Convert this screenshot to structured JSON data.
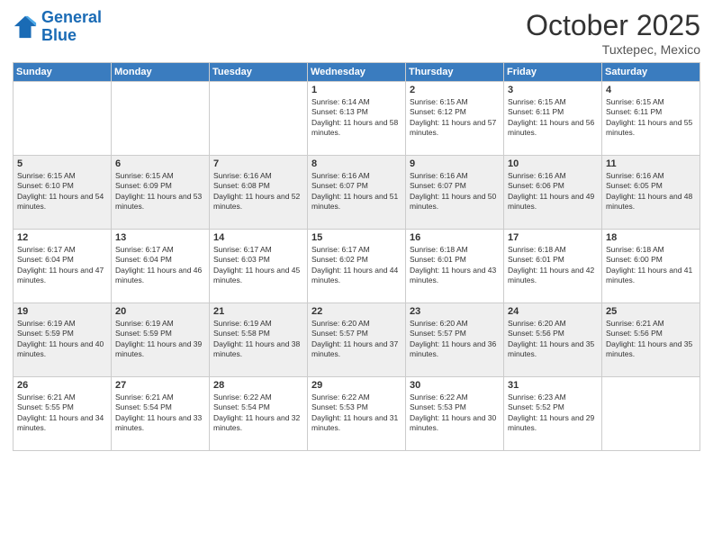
{
  "header": {
    "logo_line1": "General",
    "logo_line2": "Blue",
    "month": "October 2025",
    "location": "Tuxtepec, Mexico"
  },
  "days_of_week": [
    "Sunday",
    "Monday",
    "Tuesday",
    "Wednesday",
    "Thursday",
    "Friday",
    "Saturday"
  ],
  "weeks": [
    [
      {
        "day": "",
        "sunrise": "",
        "sunset": "",
        "daylight": ""
      },
      {
        "day": "",
        "sunrise": "",
        "sunset": "",
        "daylight": ""
      },
      {
        "day": "",
        "sunrise": "",
        "sunset": "",
        "daylight": ""
      },
      {
        "day": "1",
        "sunrise": "Sunrise: 6:14 AM",
        "sunset": "Sunset: 6:13 PM",
        "daylight": "Daylight: 11 hours and 58 minutes."
      },
      {
        "day": "2",
        "sunrise": "Sunrise: 6:15 AM",
        "sunset": "Sunset: 6:12 PM",
        "daylight": "Daylight: 11 hours and 57 minutes."
      },
      {
        "day": "3",
        "sunrise": "Sunrise: 6:15 AM",
        "sunset": "Sunset: 6:11 PM",
        "daylight": "Daylight: 11 hours and 56 minutes."
      },
      {
        "day": "4",
        "sunrise": "Sunrise: 6:15 AM",
        "sunset": "Sunset: 6:11 PM",
        "daylight": "Daylight: 11 hours and 55 minutes."
      }
    ],
    [
      {
        "day": "5",
        "sunrise": "Sunrise: 6:15 AM",
        "sunset": "Sunset: 6:10 PM",
        "daylight": "Daylight: 11 hours and 54 minutes."
      },
      {
        "day": "6",
        "sunrise": "Sunrise: 6:15 AM",
        "sunset": "Sunset: 6:09 PM",
        "daylight": "Daylight: 11 hours and 53 minutes."
      },
      {
        "day": "7",
        "sunrise": "Sunrise: 6:16 AM",
        "sunset": "Sunset: 6:08 PM",
        "daylight": "Daylight: 11 hours and 52 minutes."
      },
      {
        "day": "8",
        "sunrise": "Sunrise: 6:16 AM",
        "sunset": "Sunset: 6:07 PM",
        "daylight": "Daylight: 11 hours and 51 minutes."
      },
      {
        "day": "9",
        "sunrise": "Sunrise: 6:16 AM",
        "sunset": "Sunset: 6:07 PM",
        "daylight": "Daylight: 11 hours and 50 minutes."
      },
      {
        "day": "10",
        "sunrise": "Sunrise: 6:16 AM",
        "sunset": "Sunset: 6:06 PM",
        "daylight": "Daylight: 11 hours and 49 minutes."
      },
      {
        "day": "11",
        "sunrise": "Sunrise: 6:16 AM",
        "sunset": "Sunset: 6:05 PM",
        "daylight": "Daylight: 11 hours and 48 minutes."
      }
    ],
    [
      {
        "day": "12",
        "sunrise": "Sunrise: 6:17 AM",
        "sunset": "Sunset: 6:04 PM",
        "daylight": "Daylight: 11 hours and 47 minutes."
      },
      {
        "day": "13",
        "sunrise": "Sunrise: 6:17 AM",
        "sunset": "Sunset: 6:04 PM",
        "daylight": "Daylight: 11 hours and 46 minutes."
      },
      {
        "day": "14",
        "sunrise": "Sunrise: 6:17 AM",
        "sunset": "Sunset: 6:03 PM",
        "daylight": "Daylight: 11 hours and 45 minutes."
      },
      {
        "day": "15",
        "sunrise": "Sunrise: 6:17 AM",
        "sunset": "Sunset: 6:02 PM",
        "daylight": "Daylight: 11 hours and 44 minutes."
      },
      {
        "day": "16",
        "sunrise": "Sunrise: 6:18 AM",
        "sunset": "Sunset: 6:01 PM",
        "daylight": "Daylight: 11 hours and 43 minutes."
      },
      {
        "day": "17",
        "sunrise": "Sunrise: 6:18 AM",
        "sunset": "Sunset: 6:01 PM",
        "daylight": "Daylight: 11 hours and 42 minutes."
      },
      {
        "day": "18",
        "sunrise": "Sunrise: 6:18 AM",
        "sunset": "Sunset: 6:00 PM",
        "daylight": "Daylight: 11 hours and 41 minutes."
      }
    ],
    [
      {
        "day": "19",
        "sunrise": "Sunrise: 6:19 AM",
        "sunset": "Sunset: 5:59 PM",
        "daylight": "Daylight: 11 hours and 40 minutes."
      },
      {
        "day": "20",
        "sunrise": "Sunrise: 6:19 AM",
        "sunset": "Sunset: 5:59 PM",
        "daylight": "Daylight: 11 hours and 39 minutes."
      },
      {
        "day": "21",
        "sunrise": "Sunrise: 6:19 AM",
        "sunset": "Sunset: 5:58 PM",
        "daylight": "Daylight: 11 hours and 38 minutes."
      },
      {
        "day": "22",
        "sunrise": "Sunrise: 6:20 AM",
        "sunset": "Sunset: 5:57 PM",
        "daylight": "Daylight: 11 hours and 37 minutes."
      },
      {
        "day": "23",
        "sunrise": "Sunrise: 6:20 AM",
        "sunset": "Sunset: 5:57 PM",
        "daylight": "Daylight: 11 hours and 36 minutes."
      },
      {
        "day": "24",
        "sunrise": "Sunrise: 6:20 AM",
        "sunset": "Sunset: 5:56 PM",
        "daylight": "Daylight: 11 hours and 35 minutes."
      },
      {
        "day": "25",
        "sunrise": "Sunrise: 6:21 AM",
        "sunset": "Sunset: 5:56 PM",
        "daylight": "Daylight: 11 hours and 35 minutes."
      }
    ],
    [
      {
        "day": "26",
        "sunrise": "Sunrise: 6:21 AM",
        "sunset": "Sunset: 5:55 PM",
        "daylight": "Daylight: 11 hours and 34 minutes."
      },
      {
        "day": "27",
        "sunrise": "Sunrise: 6:21 AM",
        "sunset": "Sunset: 5:54 PM",
        "daylight": "Daylight: 11 hours and 33 minutes."
      },
      {
        "day": "28",
        "sunrise": "Sunrise: 6:22 AM",
        "sunset": "Sunset: 5:54 PM",
        "daylight": "Daylight: 11 hours and 32 minutes."
      },
      {
        "day": "29",
        "sunrise": "Sunrise: 6:22 AM",
        "sunset": "Sunset: 5:53 PM",
        "daylight": "Daylight: 11 hours and 31 minutes."
      },
      {
        "day": "30",
        "sunrise": "Sunrise: 6:22 AM",
        "sunset": "Sunset: 5:53 PM",
        "daylight": "Daylight: 11 hours and 30 minutes."
      },
      {
        "day": "31",
        "sunrise": "Sunrise: 6:23 AM",
        "sunset": "Sunset: 5:52 PM",
        "daylight": "Daylight: 11 hours and 29 minutes."
      },
      {
        "day": "",
        "sunrise": "",
        "sunset": "",
        "daylight": ""
      }
    ]
  ]
}
